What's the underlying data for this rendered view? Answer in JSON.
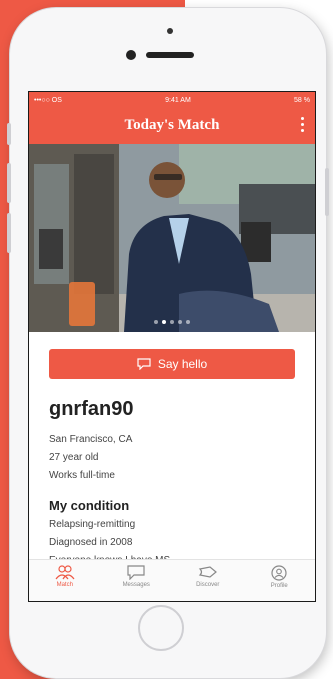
{
  "colors": {
    "accent": "#ee5945",
    "text": "#222222",
    "muted": "#444444"
  },
  "status_bar": {
    "carrier": "•••○○ OS",
    "time": "9:41 AM",
    "battery": "58 %"
  },
  "header": {
    "title": "Today's Match",
    "menu_icon": "more-vertical-icon"
  },
  "photo": {
    "carousel_dots": 5,
    "active_dot": 1
  },
  "actions": {
    "say_hello_label": "Say hello",
    "say_hello_icon": "chat-bubble-icon"
  },
  "profile": {
    "username": "gnrfan90",
    "location": "San Francisco, CA",
    "age": "27 year old",
    "work": "Works full-time"
  },
  "condition": {
    "title": "My condition",
    "type": "Relapsing-remitting",
    "diagnosed": "Diagnosed in 2008",
    "disclosure": "Everyone knows I have MS"
  },
  "tabs": [
    {
      "label": "Match",
      "icon": "people-icon",
      "active": true
    },
    {
      "label": "Messages",
      "icon": "message-icon",
      "active": false
    },
    {
      "label": "Discover",
      "icon": "tag-icon",
      "active": false
    },
    {
      "label": "Profile",
      "icon": "user-circle-icon",
      "active": false
    }
  ]
}
